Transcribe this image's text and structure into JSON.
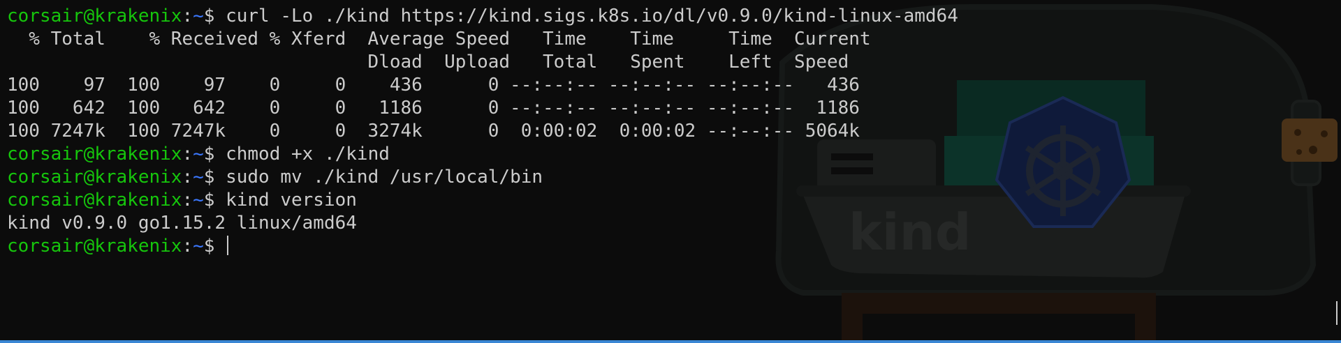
{
  "prompt": {
    "user_host": "corsair@krakenix",
    "colon": ":",
    "path": "~",
    "symbol": "$"
  },
  "commands": {
    "curl": "curl -Lo ./kind https://kind.sigs.k8s.io/dl/v0.9.0/kind-linux-amd64",
    "chmod": "chmod +x ./kind",
    "mv": "sudo mv ./kind /usr/local/bin",
    "version": "kind version"
  },
  "curl_progress": {
    "header1": "  % Total    % Received % Xferd  Average Speed   Time    Time     Time  Current",
    "header2": "                                 Dload  Upload   Total   Spent    Left  Speed",
    "rows": [
      "100    97  100    97    0     0    436      0 --:--:-- --:--:-- --:--:--   436",
      "100   642  100   642    0     0   1186      0 --:--:-- --:--:-- --:--:--  1186",
      "100 7247k  100 7247k    0     0  3274k      0  0:00:02  0:00:02 --:--:-- 5064k"
    ]
  },
  "version_output": "kind v0.9.0 go1.15.2 linux/amd64",
  "background_image": {
    "icon": "kind-bottle-logo",
    "text": "kind"
  },
  "colors": {
    "background": "#0c0c0c",
    "user": "#16c60c",
    "path": "#3b78ff",
    "text": "#cccccc",
    "status_bar": "#3a86d4"
  }
}
